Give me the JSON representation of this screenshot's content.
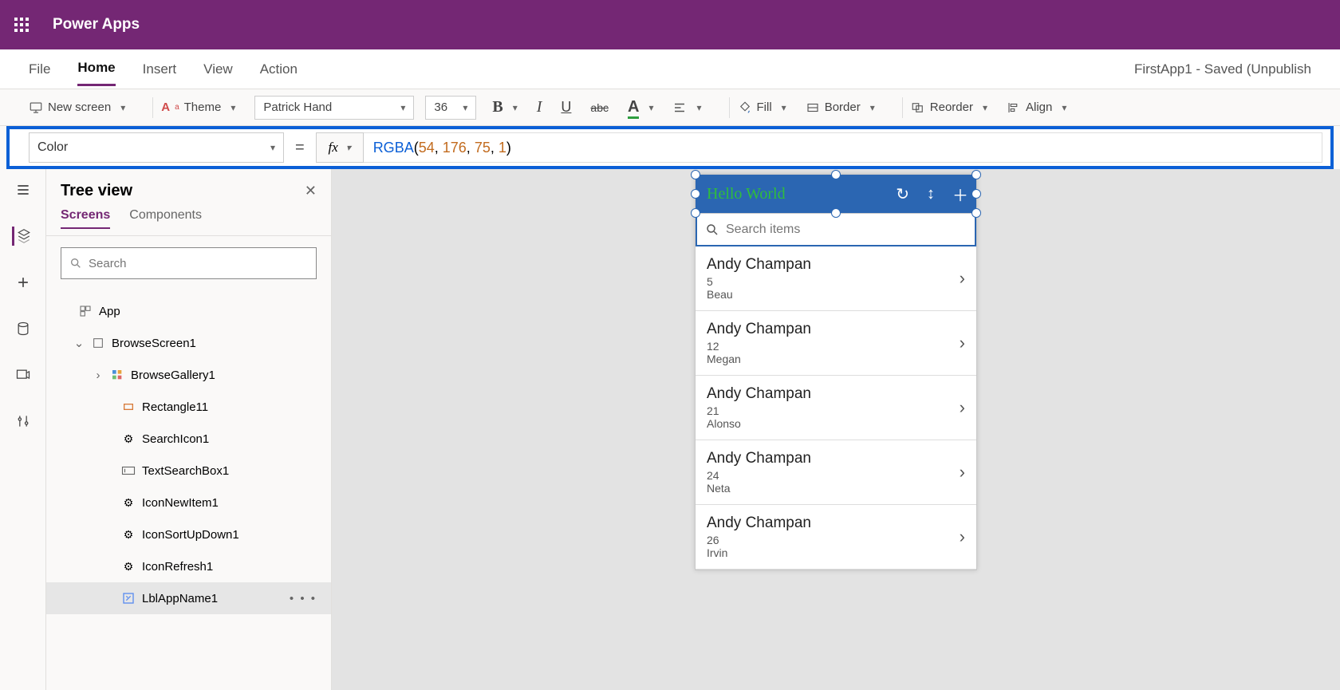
{
  "header": {
    "app_title": "Power Apps"
  },
  "menu": {
    "items": [
      "File",
      "Home",
      "Insert",
      "View",
      "Action"
    ],
    "active_index": 1,
    "status": "FirstApp1 - Saved (Unpublish"
  },
  "ribbon": {
    "new_screen": "New screen",
    "theme": "Theme",
    "font": "Patrick Hand",
    "font_size": "36",
    "fill": "Fill",
    "border": "Border",
    "reorder": "Reorder",
    "align": "Align"
  },
  "formula": {
    "property": "Color",
    "fx": "fx",
    "fn": "RGBA",
    "args": [
      "54",
      "176",
      "75",
      "1"
    ]
  },
  "tree": {
    "title": "Tree view",
    "tabs": [
      "Screens",
      "Components"
    ],
    "active_tab": 0,
    "search_placeholder": "Search",
    "nodes": [
      {
        "label": "App",
        "icon": "app"
      },
      {
        "label": "BrowseScreen1",
        "icon": "screen",
        "expanded": true
      },
      {
        "label": "BrowseGallery1",
        "icon": "gallery"
      },
      {
        "label": "Rectangle11",
        "icon": "rect"
      },
      {
        "label": "SearchIcon1",
        "icon": "ctrl"
      },
      {
        "label": "TextSearchBox1",
        "icon": "textbox"
      },
      {
        "label": "IconNewItem1",
        "icon": "ctrl"
      },
      {
        "label": "IconSortUpDown1",
        "icon": "ctrl"
      },
      {
        "label": "IconRefresh1",
        "icon": "ctrl"
      },
      {
        "label": "LblAppName1",
        "icon": "label",
        "selected": true
      }
    ]
  },
  "canvas": {
    "header_text": "Hello World",
    "search_placeholder": "Search items",
    "list": [
      {
        "name": "Andy Champan",
        "num": "5",
        "sub": "Beau"
      },
      {
        "name": "Andy Champan",
        "num": "12",
        "sub": "Megan"
      },
      {
        "name": "Andy Champan",
        "num": "21",
        "sub": "Alonso"
      },
      {
        "name": "Andy Champan",
        "num": "24",
        "sub": "Neta"
      },
      {
        "name": "Andy Champan",
        "num": "26",
        "sub": "Irvin"
      }
    ]
  }
}
